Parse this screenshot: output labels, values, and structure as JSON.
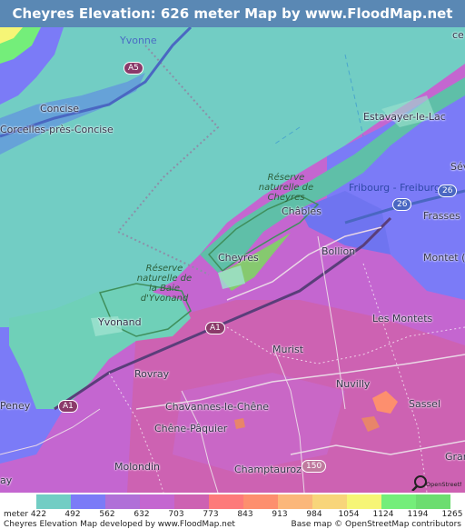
{
  "title": "Cheyres Elevation: 626 meter Map by www.FloodMap.net (beta)",
  "places": {
    "yvonne": "Yvonne",
    "concise": "Concise",
    "corcelles": "Corcelles-près-Concise",
    "estavayer": "Estavayer-le-Lac",
    "sev": "Sév",
    "chables": "Châbles",
    "fribourg": "Fribourg - Freiburg",
    "frasses": "Frasses",
    "bollion": "Bollion",
    "cheyres": "Cheyres",
    "montet": "Montet (Bro",
    "yvonand": "Yvonand",
    "montets": "Les Montets",
    "murist": "Murist",
    "rovray": "Rovray",
    "nuvilly": "Nuvilly",
    "sassel": "Sassel",
    "chavannes": "Chavannes-le-Chêne",
    "chene_paquier": "Chêne-Pâquier",
    "molondin": "Molondin",
    "champtauroz": "Champtauroz",
    "peney": "Peney",
    "gran": "Gran",
    "ay": "ay",
    "ce": "ce",
    "reserve_cheyres": "Réserve naturelle de Cheyres",
    "reserve_yvonand": "Réserve naturelle de la Baie d'Yvonand"
  },
  "roads": {
    "a5": "A5",
    "a1_north": "A1",
    "a1_south": "A1",
    "r26_a": "26",
    "r26_b": "26",
    "r150": "150"
  },
  "osm_logo_label": "OpenStreetMap",
  "legend": {
    "unit_label": "meter 422",
    "colors": [
      "#72CDC4",
      "#7B7BF7",
      "#B070D8",
      "#C466D0",
      "#CD62B2",
      "#FD7A7A",
      "#FD8F6E",
      "#FBB77A",
      "#F8D57A",
      "#F6F576",
      "#74EE7A",
      "#6CDD70"
    ],
    "ticks": [
      "492",
      "562",
      "632",
      "703",
      "773",
      "843",
      "913",
      "984",
      "1054",
      "1124",
      "1194",
      "1265"
    ]
  },
  "credits": {
    "left": "Cheyres Elevation Map developed by www.FloodMap.net",
    "right": "Base map © OpenStreetMap contributors"
  }
}
